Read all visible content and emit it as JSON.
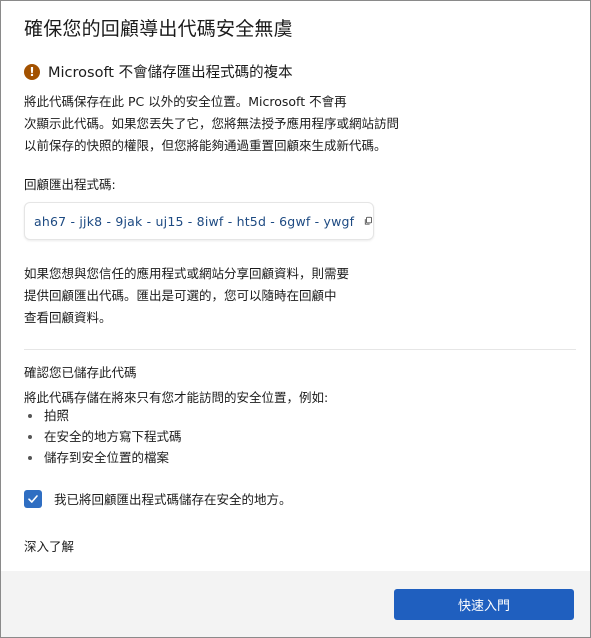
{
  "dialog": {
    "title": "確保您的回顧導出代碼安全無虞",
    "warning": {
      "icon": "warning-icon",
      "title": "Microsoft 不會儲存匯出程式碼的複本"
    },
    "intro_lines": [
      "將此代碼保存在此 PC 以外的安全位置。Microsoft 不會再",
      "次顯示此代碼。如果您丟失了它，您將無法授予應用程序或網站訪問",
      "以前保存的快照的權限，但您將能夠通過重置回顧來生成新代碼。"
    ],
    "code_label": "回顧匯出程式碼:",
    "code_value": "ah67 - jjk8 - 9jak - uj15 - 8iwf - ht5d - 6gwf - ywgf",
    "share_lines": [
      "如果您想與您信任的應用程式或網站分享回顧資料，則需要",
      "提供回顧匯出代碼。匯出是可選的，您可以隨時在回顧中",
      "查看回顧資料。"
    ],
    "confirm_heading": "確認您已儲存此代碼",
    "confirm_desc": "將此代碼存儲在將來只有您才能訪問的安全位置，例如:",
    "bullets": [
      "拍照",
      "在安全的地方寫下程式碼",
      "儲存到安全位置的檔案"
    ],
    "checkbox_label": "我已將回顧匯出程式碼儲存在安全的地方。",
    "checkbox_checked": true,
    "learn_more": "深入了解",
    "primary_button": "快速入門"
  },
  "colors": {
    "accent": "#1f5fbf",
    "warning": "#a35200",
    "code_text": "#1d4a82",
    "footer_bg": "#f3f3f3"
  }
}
